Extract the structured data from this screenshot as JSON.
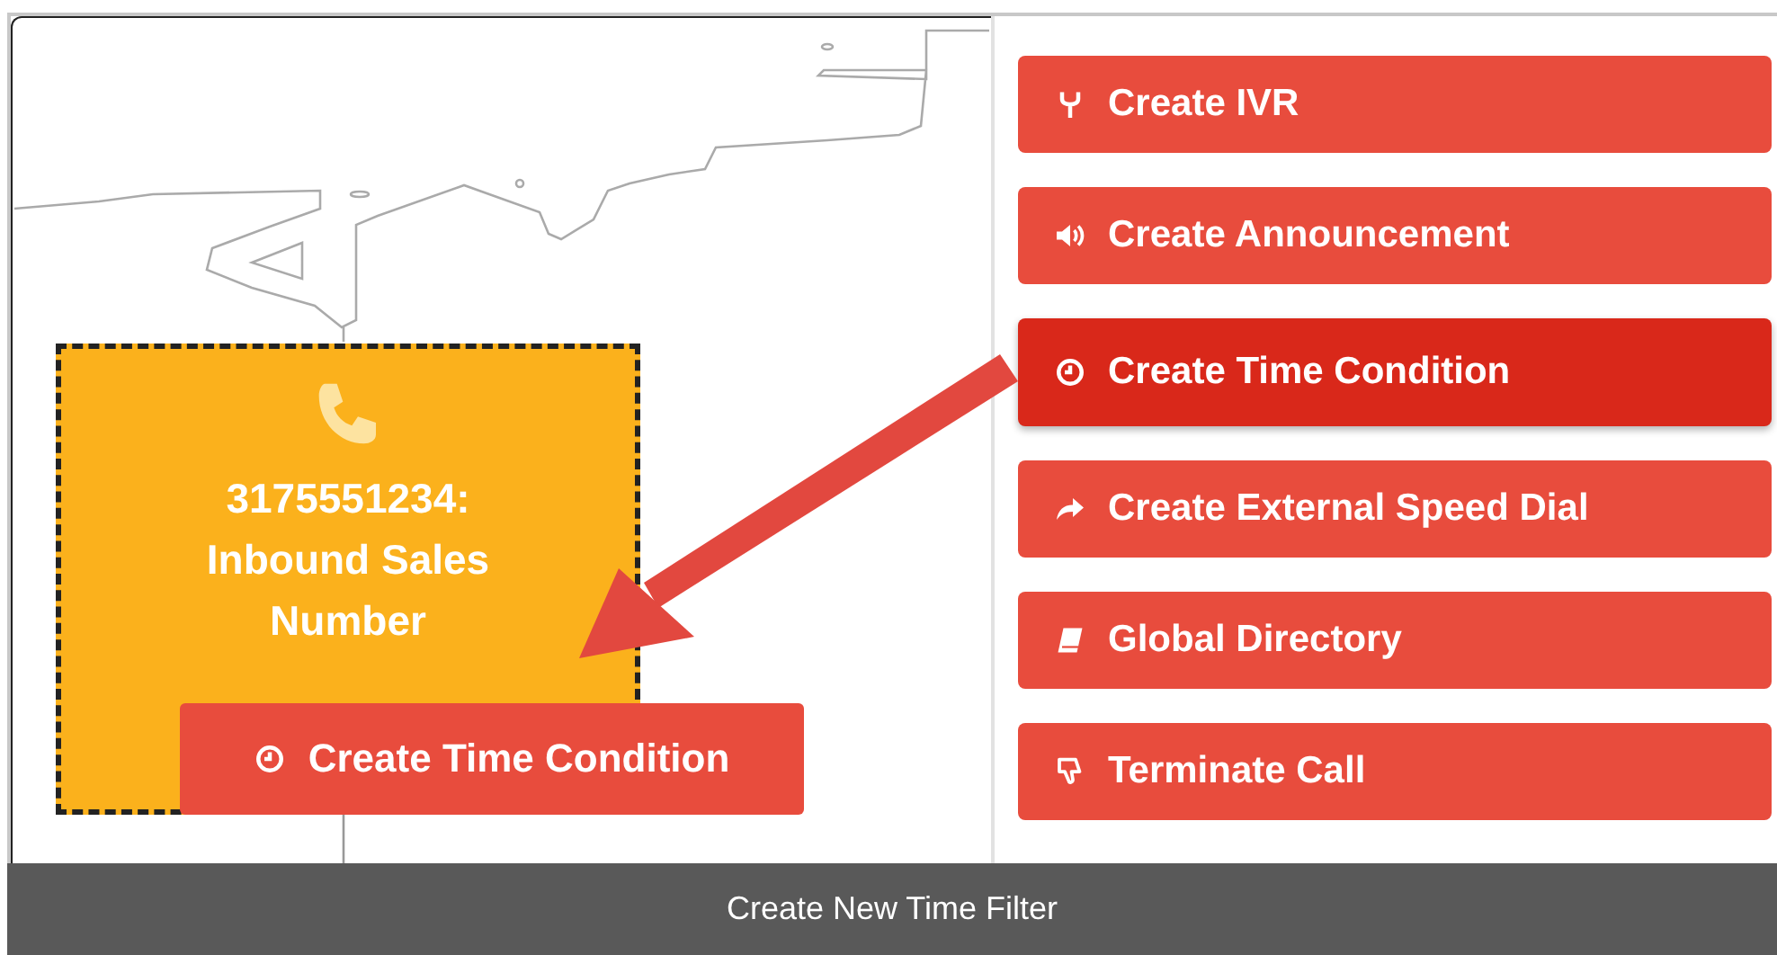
{
  "canvas": {
    "node": {
      "kind": "phone",
      "lines": [
        "3175551234:",
        "Inbound Sales",
        "Number"
      ]
    },
    "popup_button": {
      "kind": "clock",
      "label": "Create Time Condition"
    }
  },
  "actions": [
    {
      "kind": "ivr",
      "label": "Create IVR",
      "selected": false
    },
    {
      "kind": "speaker",
      "label": "Create Announcement",
      "selected": false
    },
    {
      "kind": "clock",
      "label": "Create Time Condition",
      "selected": true
    },
    {
      "kind": "share",
      "label": "Create External Speed Dial",
      "selected": false
    },
    {
      "kind": "book",
      "label": "Global Directory",
      "selected": false
    },
    {
      "kind": "thumbs-down",
      "label": "Terminate Call",
      "selected": false
    }
  ],
  "caption": "Create New Time Filter"
}
